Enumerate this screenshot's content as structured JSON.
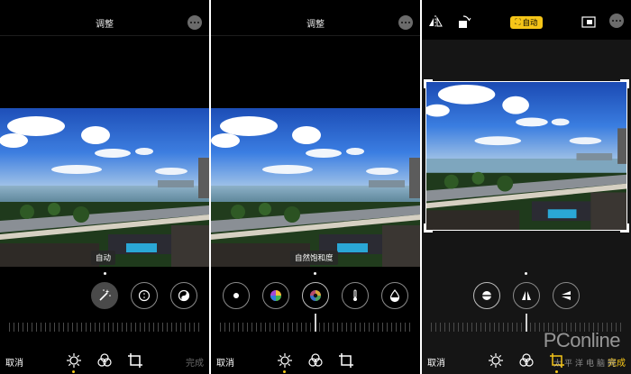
{
  "panel1": {
    "title": "调整",
    "label": "自动",
    "tools": [
      "magic-wand-icon",
      "brilliance-icon",
      "yin-yang-icon"
    ],
    "cancel": "取消",
    "done": "完成"
  },
  "panel2": {
    "title": "调整",
    "label": "自然饱和度",
    "tools": [
      "brightness-icon",
      "saturation-icon",
      "vibrance-icon",
      "temperature-icon",
      "tint-icon"
    ],
    "cancel": "取消"
  },
  "panel3": {
    "auto_label": "自动",
    "tools": [
      "straighten-icon",
      "vertical-perspective-icon",
      "horizontal-perspective-icon"
    ],
    "cancel": "取消",
    "done": "完成"
  },
  "watermark": {
    "brand": "PConline",
    "subtitle": "太平洋电脑网"
  },
  "colors": {
    "accent": "#f5c518",
    "background": "#000000"
  }
}
